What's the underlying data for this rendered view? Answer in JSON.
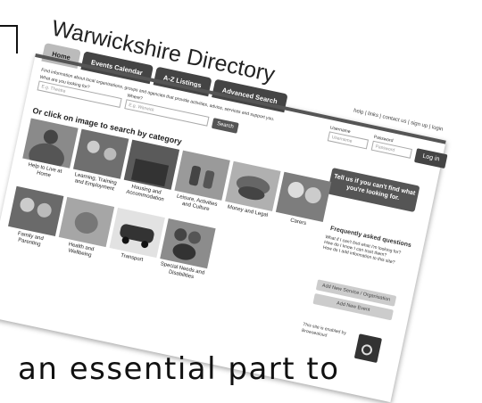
{
  "site": {
    "title": "Warwickshire Directory",
    "tabs": [
      "Home",
      "Events Calendar",
      "A-Z Listings",
      "Advanced Search"
    ],
    "top_links": "help | links | contact us | sign up | login",
    "intro": "Find information about local organisations, groups and agencies that provide activities, advice, services and support you.",
    "what_label": "What are you looking for?",
    "what_placeholder": "E.g. Theatre",
    "where_label": "Where?",
    "where_placeholder": "E.g. Warwick",
    "search_button": "Search",
    "username_label": "Username",
    "username_placeholder": "Username",
    "password_label": "Password",
    "password_placeholder": "Password",
    "login_button": "Log in",
    "category_heading": "Or click on image to search by category",
    "tell_us": "Tell us if you can't find what you're looking for.",
    "categories": [
      "Help to Live at Home",
      "Learning, Training and Employment",
      "Housing and Accommodation",
      "Leisure, Activities and Culture",
      "Money and Legal",
      "Carers",
      "Family and Parenting",
      "Health and Wellbeing",
      "Transport",
      "Special Needs and Disabilities"
    ],
    "faq_heading": "Frequently asked questions",
    "faq_items": [
      "What if I can't find what I'm looking for?",
      "How do I know I can trust them?",
      "How do I add information to this site?"
    ],
    "add_service_button": "Add New Service / Organisation",
    "add_event_button": "Add New Event",
    "enabled_by": "This site is enabled by",
    "provider": "Browsealoud"
  },
  "caption": "an essential part to"
}
